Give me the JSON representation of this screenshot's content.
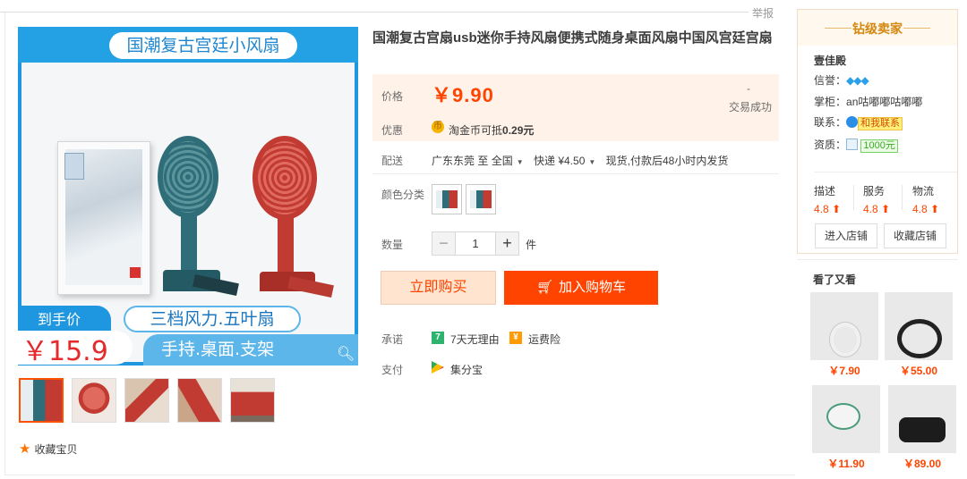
{
  "report": "举报",
  "gallery": {
    "banner_title": "国潮复古宫廷小风扇",
    "price_label": "到手价",
    "price_value": "￥15.9",
    "feature1": "三档风力.五叶扇",
    "feature2": "手持.桌面.支架",
    "thumbs": [
      "thumb1",
      "thumb2",
      "thumb3",
      "thumb4",
      "thumb5"
    ],
    "favorite": "收藏宝贝"
  },
  "product": {
    "title": "国潮复古宫扇usb迷你手持风扇便携式随身桌面风扇中国风宫廷宫扇",
    "price_label": "价格",
    "price": "￥9.90",
    "sold_count": "-",
    "sold_label": "交易成功",
    "promo_label": "优惠",
    "promo_text_pre": "淘金币可抵",
    "promo_amount": "0.29元",
    "ship_label": "配送",
    "ship_from": "广东东莞",
    "ship_to_word": "至",
    "ship_to": "全国",
    "ship_method": "快递 ¥4.50",
    "ship_note": "现货,付款后48小时内发货",
    "color_label": "颜色分类",
    "qty_label": "数量",
    "qty_value": "1",
    "qty_unit": "件",
    "buy_now": "立即购买",
    "add_cart": "加入购物车",
    "promise_label": "承诺",
    "promise1": "7天无理由",
    "promise2": "运费险",
    "pay_label": "支付",
    "pay_method": "集分宝"
  },
  "seller": {
    "rank": "钻级卖家",
    "shop_name": "壹佳殿",
    "credit_label": "信誉：",
    "credit_diamonds": "💎💎💎",
    "keeper_label": "掌柜：",
    "keeper": "an咕嘟嘟咕嘟嘟",
    "contact_label": "联系：",
    "contact_btn": "和我联系",
    "qual_label": "资质：",
    "qual_amount": "1000元",
    "scores": [
      {
        "name": "描述",
        "value": "4.8 ⬆"
      },
      {
        "name": "服务",
        "value": "4.8 ⬆"
      },
      {
        "name": "物流",
        "value": "4.8 ⬆"
      }
    ],
    "enter_shop": "进入店铺",
    "fav_shop": "收藏店铺"
  },
  "also_viewed": {
    "title": "看了又看",
    "items": [
      {
        "price": "￥7.90"
      },
      {
        "price": "￥55.00"
      },
      {
        "price": "￥11.90"
      },
      {
        "price": "￥89.00"
      }
    ]
  }
}
